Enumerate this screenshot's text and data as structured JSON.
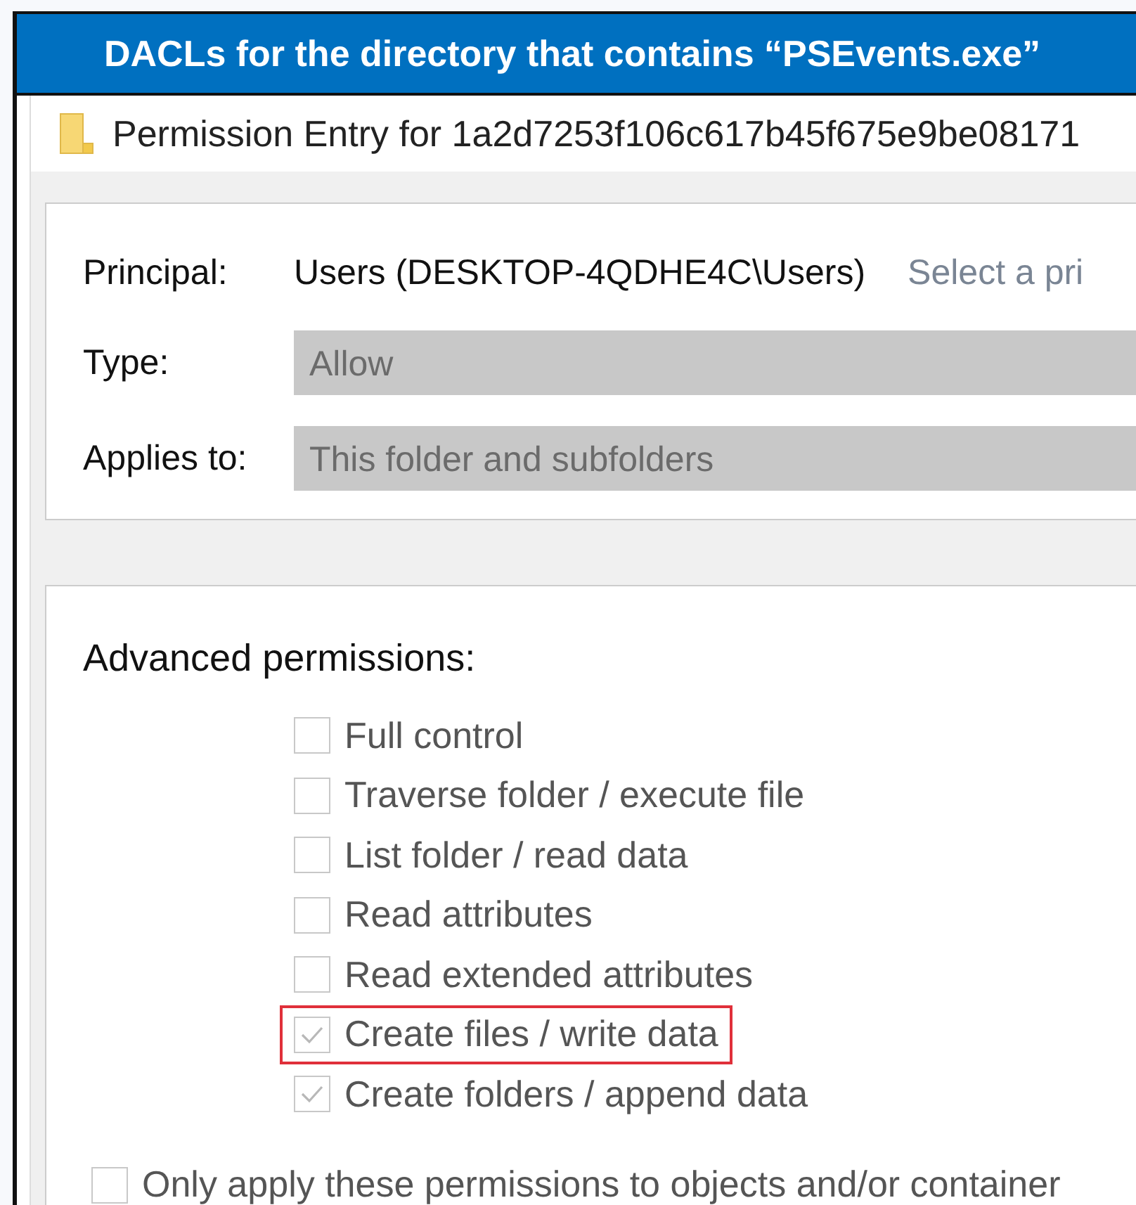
{
  "banner": {
    "title": "DACLs for the directory that contains “PSEvents.exe”"
  },
  "window": {
    "title": "Permission Entry for 1a2d7253f106c617b45f675e9be08171"
  },
  "principal": {
    "label": "Principal:",
    "value": "Users (DESKTOP-4QDHE4C\\Users)",
    "link": "Select a pri"
  },
  "fields": [
    {
      "label": "Type:",
      "value": "Allow",
      "disabled": true
    },
    {
      "label": "Applies to:",
      "value": "This folder and subfolders",
      "disabled": true
    }
  ],
  "advanced": {
    "heading": "Advanced permissions:",
    "permissions": [
      {
        "label": "Full control",
        "checked": false,
        "highlighted": false
      },
      {
        "label": "Traverse folder / execute file",
        "checked": false,
        "highlighted": false
      },
      {
        "label": "List folder / read data",
        "checked": false,
        "highlighted": false
      },
      {
        "label": "Read attributes",
        "checked": false,
        "highlighted": false
      },
      {
        "label": "Read extended attributes",
        "checked": false,
        "highlighted": false
      },
      {
        "label": "Create files / write data",
        "checked": true,
        "highlighted": true
      },
      {
        "label": "Create folders / append data",
        "checked": true,
        "highlighted": false
      }
    ]
  },
  "only_apply": {
    "label": "Only apply these permissions to objects and/or container",
    "checked": false
  }
}
